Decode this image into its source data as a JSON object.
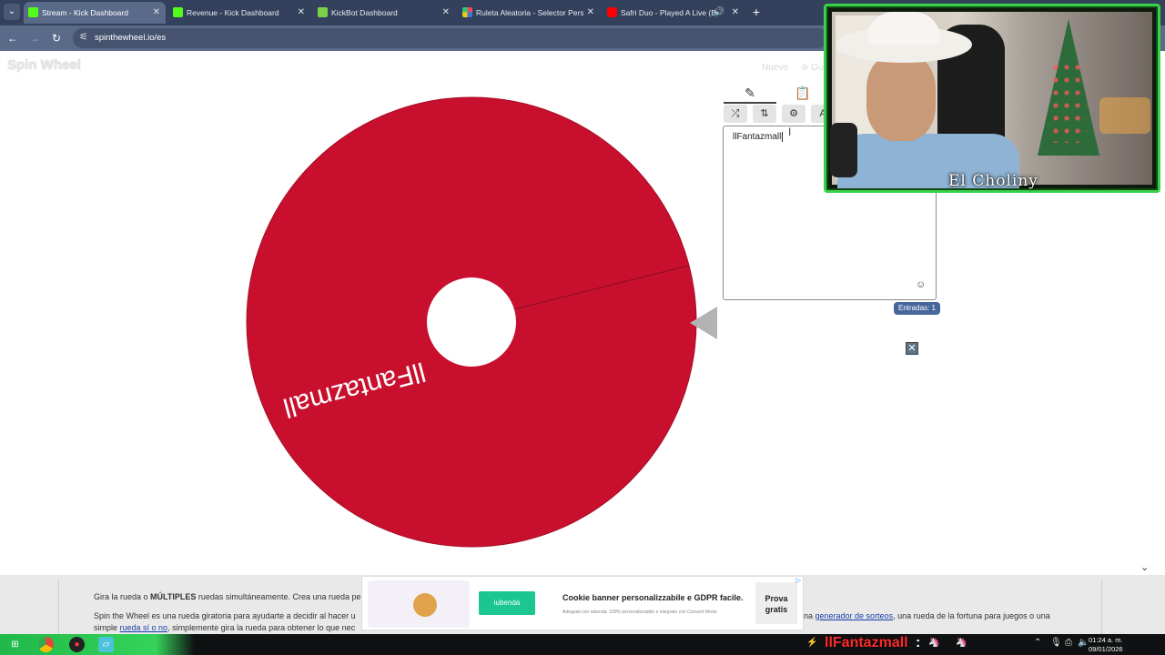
{
  "browser": {
    "tabs": [
      {
        "label": "Stream - Kick Dashboard",
        "icon": "kick-logo-icon",
        "color": "#53fc18"
      },
      {
        "label": "Revenue - Kick Dashboard",
        "icon": "kick-logo-icon",
        "color": "#53fc18"
      },
      {
        "label": "KickBot Dashboard",
        "icon": "kickbot-icon",
        "color": "#7bd148"
      },
      {
        "label": "Ruleta Aleatoria - Selector Pers",
        "icon": "spin-wheel-icon",
        "color": "#e84a5f"
      },
      {
        "label": "Safri Duo - Played A Live (B",
        "icon": "youtube-icon",
        "color": "#ff0000"
      }
    ],
    "url": "spinthewheel.io/es"
  },
  "page": {
    "logo": "Spin Wheel",
    "top_links": {
      "new": "Nuevo",
      "save": "Gu"
    }
  },
  "wheel": {
    "entry_label": "llFantazmall",
    "color": "#c8102e"
  },
  "panel": {
    "tabs": [
      {
        "icon": "pencil-icon",
        "selected": true
      },
      {
        "icon": "clipboard-icon",
        "selected": false
      }
    ],
    "tools": [
      {
        "icon": "shuffle-icon",
        "glyph": "⤮"
      },
      {
        "icon": "sort-icon",
        "glyph": "⇅"
      },
      {
        "icon": "settings-icon",
        "glyph": "⚙"
      },
      {
        "icon": "text-size-icon",
        "glyph": "A"
      }
    ],
    "entries_text": "llFantazmall",
    "entries_count_label": "Entradas: 1"
  },
  "webcam": {
    "streamer_name": "El Choliny"
  },
  "content": {
    "line1_prefix": "Gira la rueda o ",
    "line1_bold": "MÚLTIPLES",
    "line1_suffix": " ruedas simultáneamente. Crea una rueda pe",
    "line2_prefix": "Spin the Wheel es una rueda giratoria para ayudarte a decidir al hacer u",
    "line2_right_prefix": "na ",
    "line2_link": "generador de sorteos",
    "line2_right_suffix": ", una rueda de la fortuna para juegos o una",
    "line3_prefix": "simple ",
    "line3_link": "rueda sí o no",
    "line3_suffix": ", simplemente gira la rueda para obtener lo que nec"
  },
  "ad": {
    "brand": "iubenda",
    "title": "Cookie banner personalizzabile e GDPR facile.",
    "subtitle": "Adeguati con iubenda: 100% personalizzabile e integrato con Consent Mode.",
    "cta": "Prova gratis"
  },
  "taskbar": {
    "alert_name": "llFantazmall",
    "alert_sep": ":",
    "time": "01:24 a. m.",
    "date": "09/01/2026"
  }
}
